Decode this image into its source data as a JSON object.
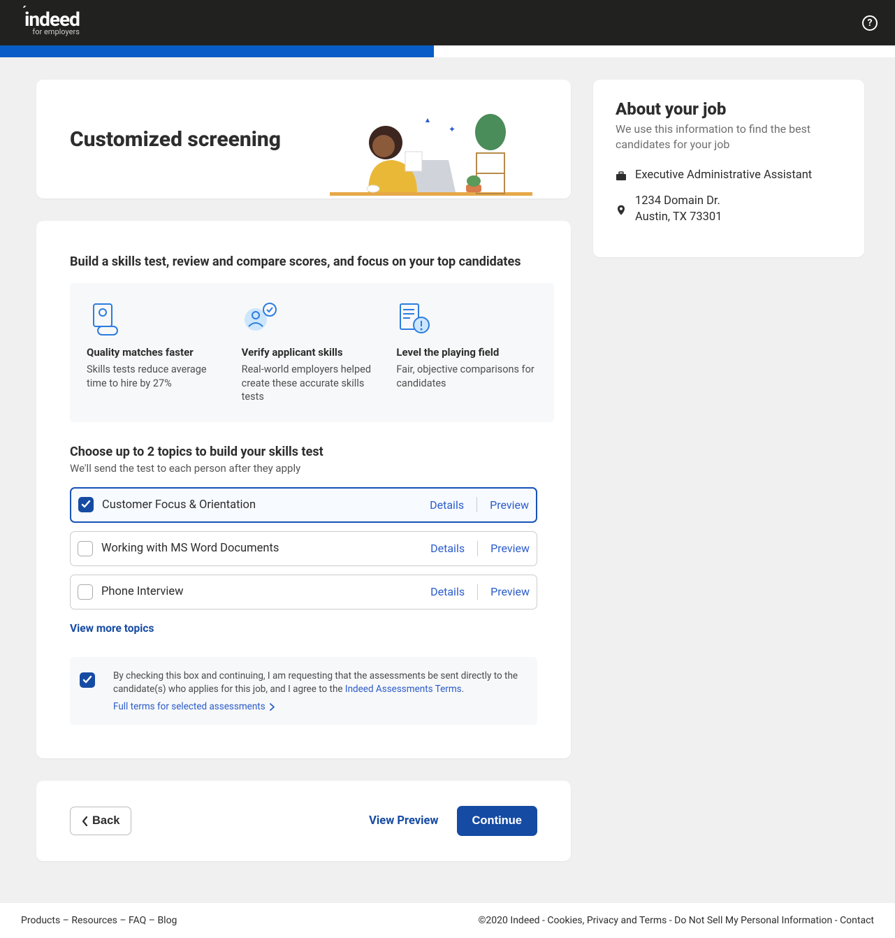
{
  "header": {
    "logo_main": "indeed",
    "logo_sub": "for employers"
  },
  "hero": {
    "title": "Customized screening"
  },
  "main": {
    "section_title": "Build a skills test, review and compare scores, and focus on your top candidates",
    "features": [
      {
        "title": "Quality matches faster",
        "desc": "Skills tests reduce average time to hire by 27%"
      },
      {
        "title": "Verify applicant skills",
        "desc": "Real-world employers helped create these accurate skills tests"
      },
      {
        "title": "Level the playing field",
        "desc": "Fair, objective comparisons for candidates"
      }
    ],
    "choose_title": "Choose up to 2 topics to build your skills test",
    "choose_sub": "We'll send the test to each person after they apply",
    "topics": [
      {
        "label": "Customer Focus & Orientation",
        "checked": true
      },
      {
        "label": "Working with MS Word Documents",
        "checked": false
      },
      {
        "label": "Phone Interview",
        "checked": false
      }
    ],
    "details_label": "Details",
    "preview_label": "Preview",
    "view_more": "View more topics",
    "consent_text_1": "By checking this box and continuing, I am requesting that the assessments be sent directly to the candidate(s) who applies for this job, and I agree to the ",
    "consent_link": "Indeed Assessments Terms",
    "consent_text_2": ".",
    "full_terms": "Full terms for selected assessments"
  },
  "nav": {
    "back": "Back",
    "view_preview": "View Preview",
    "continue": "Continue"
  },
  "about": {
    "title": "About your job",
    "sub": "We use this information to find the best candidates for your job",
    "job_title": "Executive Administrative Assistant",
    "address_line1": "1234 Domain Dr.",
    "address_line2": "Austin, TX 73301"
  },
  "footer": {
    "left": [
      "Products",
      "Resources",
      "FAQ",
      "Blog"
    ],
    "right_prefix": "©2020 Indeed - ",
    "right": [
      "Cookies, Privacy and Terms",
      "Do Not Sell My Personal Information",
      "Contact"
    ]
  }
}
